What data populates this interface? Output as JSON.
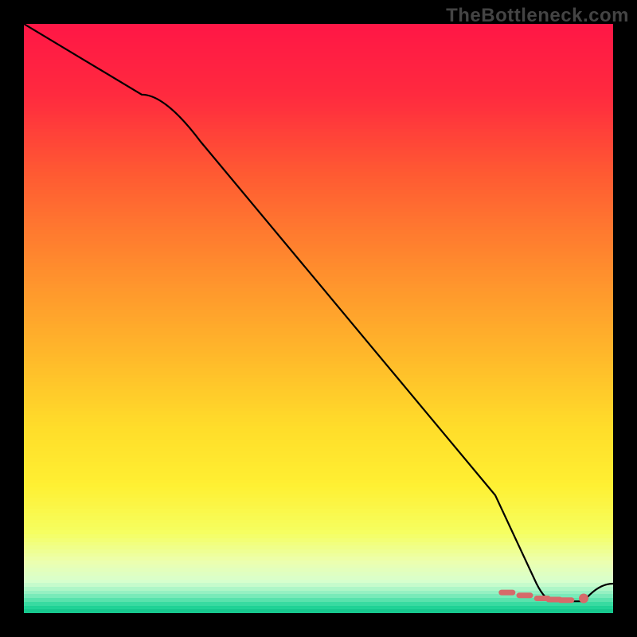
{
  "watermark": "TheBottleneck.com",
  "chart_data": {
    "type": "line",
    "title": "",
    "xlabel": "",
    "ylabel": "",
    "xlim": [
      0,
      100
    ],
    "ylim": [
      0,
      100
    ],
    "series": [
      {
        "name": "curve",
        "x": [
          0,
          10,
          20,
          30,
          40,
          50,
          60,
          70,
          80,
          87,
          90,
          95,
          100
        ],
        "values": [
          100,
          94,
          88,
          80,
          68,
          56,
          44,
          32,
          20,
          5,
          2,
          2,
          5
        ]
      }
    ],
    "markers": {
      "style": "dash-and-dot",
      "color": "#d66a6a",
      "points": [
        {
          "x": 82,
          "y": 3.5,
          "kind": "dash"
        },
        {
          "x": 85,
          "y": 3,
          "kind": "dash"
        },
        {
          "x": 88,
          "y": 2.5,
          "kind": "dash"
        },
        {
          "x": 90,
          "y": 2.3,
          "kind": "dash"
        },
        {
          "x": 92,
          "y": 2.2,
          "kind": "dash"
        },
        {
          "x": 95,
          "y": 2.5,
          "kind": "dot"
        }
      ]
    },
    "gradient_stops": [
      {
        "pos": 0.0,
        "color": "#ff1846"
      },
      {
        "pos": 0.12,
        "color": "#ff2b3f"
      },
      {
        "pos": 0.25,
        "color": "#ff5a33"
      },
      {
        "pos": 0.4,
        "color": "#ff8a2e"
      },
      {
        "pos": 0.55,
        "color": "#ffb62b"
      },
      {
        "pos": 0.68,
        "color": "#ffdd2a"
      },
      {
        "pos": 0.78,
        "color": "#fff033"
      },
      {
        "pos": 0.86,
        "color": "#f6ff61"
      },
      {
        "pos": 0.91,
        "color": "#ecffb0"
      },
      {
        "pos": 0.945,
        "color": "#d6ffd0"
      },
      {
        "pos": 0.965,
        "color": "#8aeec0"
      },
      {
        "pos": 0.985,
        "color": "#24d69a"
      },
      {
        "pos": 1.0,
        "color": "#0fbf86"
      }
    ]
  }
}
